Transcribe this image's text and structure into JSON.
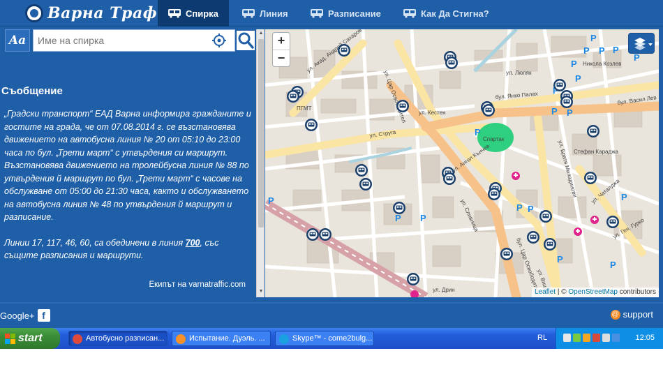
{
  "header": {
    "brand": "Варна Трафик",
    "tabs": [
      {
        "label": "Спирка",
        "active": true
      },
      {
        "label": "Линия",
        "active": false
      },
      {
        "label": "Разписание",
        "active": false
      },
      {
        "label": "Как Да Стигна?",
        "active": false
      }
    ]
  },
  "search": {
    "mode_label": "Aa",
    "placeholder": "Име на спирка"
  },
  "message": {
    "title": "Съобщение",
    "paragraph1": "„Градски транспорт“ ЕАД Варна информира гражданите и гостите на града, че от 07.08.2014 г. се възстановява движението на автобусна линия № 20 от 05:10 до 23:00 часа по бул. „Трети март“ с утвърдения си маршрут. Възстановява движението на тролейбусна линия № 88 по утвърдения й маршрут по бул. „Трети март“ с часове на обслужване от 05:00 до 21:30 часа, както и обслужването на автобусна линия № 48 по утвърдения й маршрут и разписание.",
    "paragraph2_before": "Линии 17, 117, 46, 60, са обединени в линия ",
    "paragraph2_link": "700",
    "paragraph2_after": ", със същите разписания и маршрути.",
    "credit": "Екипът на varnatraffic.com"
  },
  "map": {
    "zoom_in": "+",
    "zoom_out": "−",
    "attribution_leaflet": "Leaflet",
    "attribution_sep": " | © ",
    "attribution_osm": "OpenStreetMap",
    "attribution_tail": " contributors",
    "street_labels": [
      "ул. Акад. Андрей Сахаров",
      "ул. Цар Освободител",
      "бул. Янко Палах",
      "ул. Кестен",
      "ул. Струга",
      "Спартак",
      "Стефан Караджа",
      "ПГМТ",
      "бул. Васил Лев",
      "бул. Цар Освободител",
      "ул. Дрин",
      "Никола Козлев",
      "ул. Люляк",
      "ул. Чаталджа",
      "ул. Братя Миладинови",
      "ул. Ген. Гурко",
      "ул. Сливница",
      "ул. Вишка",
      "ул. Ангел Кънчев"
    ],
    "colors": {
      "land": "#e9e5dc",
      "major_road": "#fbe5a5",
      "primary_road": "#f7c28a",
      "park": "#2ed080",
      "railway": "#d7a2a7",
      "bus_stop": "#1a3f6b"
    }
  },
  "footer": {
    "google": "Google+",
    "facebook": "f",
    "support": "support"
  },
  "taskbar": {
    "start": "start",
    "tasks": [
      {
        "label": "Автобусно разписан...",
        "active": true,
        "icon_color": "#e04a3a"
      },
      {
        "label": "Испытание. Дуэль. ...",
        "active": false,
        "icon_color": "#f5902a"
      },
      {
        "label": "Skype™ - come2bulg...",
        "active": false,
        "icon_color": "#1ba1e2"
      }
    ],
    "lang": "RL",
    "clock": "12:05"
  }
}
